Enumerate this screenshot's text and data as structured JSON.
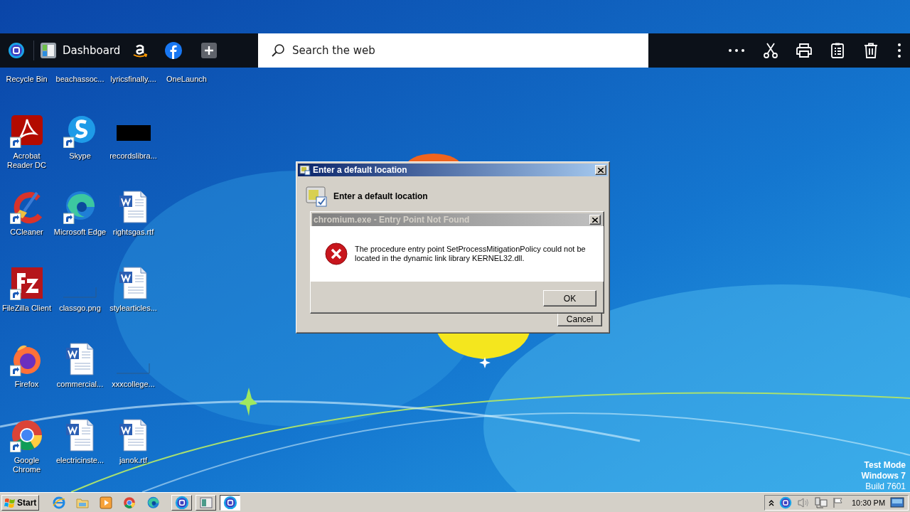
{
  "browser_toolbar": {
    "dashboard_button": {
      "label": "Dashboard"
    },
    "search": {
      "placeholder": "Search the web"
    }
  },
  "desktop_icon_rows": [
    [
      {
        "label": "Recycle Bin",
        "kind": "covered"
      },
      {
        "label": "beachassoc...",
        "kind": "covered"
      },
      {
        "label": "lyricsfinally....",
        "kind": "covered"
      },
      {
        "label": "OneLaunch",
        "kind": "covered"
      }
    ],
    [
      {
        "label": "Acrobat\nReader DC",
        "kind": "pdf",
        "shortcut": true
      },
      {
        "label": "Skype",
        "kind": "chat",
        "shortcut": true
      },
      {
        "label": "recordslibra...",
        "kind": "black-thumb",
        "shortcut": false
      }
    ],
    [
      {
        "label": "CCleaner",
        "kind": "brush",
        "shortcut": true
      },
      {
        "label": "Microsoft Edge",
        "kind": "edge",
        "shortcut": true
      },
      {
        "label": "rightsgas.rtf",
        "kind": "document",
        "shortcut": false
      }
    ],
    [
      {
        "label": "FileZilla Client",
        "kind": "ftp",
        "shortcut": true
      },
      {
        "label": "classgo.png",
        "kind": "blank-thumb",
        "shortcut": false
      },
      {
        "label": "stylearticles...",
        "kind": "document",
        "shortcut": false
      }
    ],
    [
      {
        "label": "Firefox",
        "kind": "fox",
        "shortcut": true
      },
      {
        "label": "commercial...",
        "kind": "document",
        "shortcut": false
      },
      {
        "label": "xxxcollege...",
        "kind": "blank-thumb",
        "shortcut": false
      }
    ],
    [
      {
        "label": "Google\nChrome",
        "kind": "chrome",
        "shortcut": true
      },
      {
        "label": "electricinste...",
        "kind": "document",
        "shortcut": false
      },
      {
        "label": "janok.rtf",
        "kind": "document",
        "shortcut": false
      }
    ]
  ],
  "windows": [
    {
      "title": "Enter a default location",
      "active": true,
      "heading": "Enter a default location",
      "buttons": [
        "Cancel"
      ]
    },
    {
      "title": "chromium.exe - Entry Point Not Found",
      "active": false,
      "message": "The procedure entry point SetProcessMitigationPolicy could not be located in the dynamic link library KERNEL32.dll.",
      "buttons": [
        "OK"
      ]
    }
  ],
  "system_notice": [
    {
      "text": "Test Mode",
      "bold": true
    },
    {
      "text": "Windows 7",
      "bold": true
    },
    {
      "text": "Build 7601",
      "bold": false
    }
  ],
  "taskbar": {
    "start_label": "Start",
    "task_buttons": [
      {
        "kind": "ring",
        "selected": false
      },
      {
        "kind": "window",
        "selected": false
      },
      {
        "kind": "ring",
        "selected": true
      }
    ],
    "clock": "10:30 PM"
  }
}
